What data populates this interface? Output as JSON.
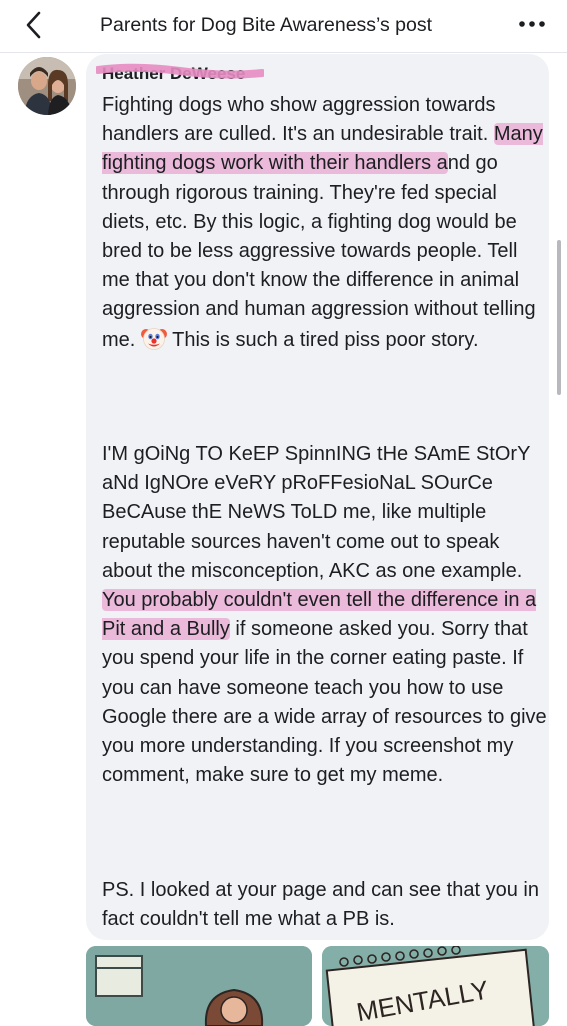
{
  "header": {
    "back_icon": "chevron-left-icon",
    "title": "Parents for Dog Bite Awareness’s post",
    "more_icon": "more-horizontal-icon"
  },
  "comment": {
    "author": "Heather DeWeese",
    "paragraph1": {
      "segments": [
        {
          "text": "Fighting dogs who show aggression towards handlers are culled. It's an undesirable trait. ",
          "highlight": false
        },
        {
          "text": "Many fighting dogs work with their handlers a",
          "highlight": true
        },
        {
          "text": "nd go through rigorous training. They're fed special diets, etc. By this logic, a fighting dog would be bred to be less aggressive towards people. Tell me that you don't know the difference in animal aggression and human aggression without telling me. ",
          "highlight": false
        },
        {
          "emoji": "clown-face-icon"
        },
        {
          "text": "  This is such a tired piss poor story.",
          "highlight": false
        }
      ]
    },
    "paragraph2": {
      "segments": [
        {
          "text": "I'M gOiNg TO KeEP SpinnING tHe SAmE StOrY aNd IgNOre eVeRY pRoFFesioNaL SOurCe BeCAuse thE NeWS ToLD me, like multiple reputable sources haven't come out to speak about the misconception, AKC as one example.  ",
          "highlight": false
        },
        {
          "text": "You probably couldn't even tell the difference in a Pit and a Bully",
          "highlight": true
        },
        {
          "text": " if someone asked you. Sorry that you spend your life in the corner eating paste. If you can have someone teach you how to use Google there are a wide array of resources to give you more understanding. If you screenshot my comment, make sure to get my meme.",
          "highlight": false
        }
      ]
    },
    "paragraph3": {
      "segments": [
        {
          "text": "PS. I looked at your page and can see that you in fact couldn't tell me what a PB is.",
          "highlight": false
        }
      ]
    }
  },
  "meme_images": [
    {
      "name": "meme-panel-woman"
    },
    {
      "name": "meme-panel-notepad",
      "sign_text": "MENTALLY"
    }
  ],
  "colors": {
    "highlight": "#e78cc3",
    "bubble": "#f0f2f5",
    "text": "#1c1e21",
    "meme_teal": "#7fa8a3"
  }
}
